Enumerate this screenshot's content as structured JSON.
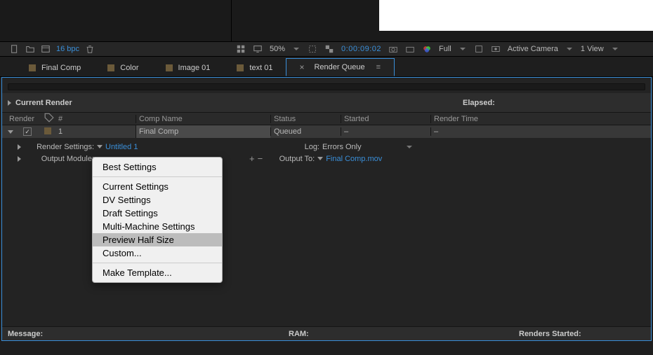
{
  "toolbar": {
    "bpc": "16 bpc",
    "zoom": "50%",
    "timecode": "0:00:09:02",
    "resolution": "Full",
    "camera": "Active Camera",
    "view": "1 View"
  },
  "tabs": [
    {
      "label": "Final Comp"
    },
    {
      "label": "Color"
    },
    {
      "label": "Image 01"
    },
    {
      "label": "text 01"
    },
    {
      "label": "Render Queue",
      "active": true,
      "closable": true
    }
  ],
  "current_render": {
    "label": "Current Render",
    "elapsed_label": "Elapsed:"
  },
  "columns": {
    "render": "Render",
    "num": "#",
    "comp": "Comp Name",
    "status": "Status",
    "started": "Started",
    "rtime": "Render Time"
  },
  "row": {
    "num": "1",
    "comp": "Final Comp",
    "status": "Queued",
    "started": "–",
    "rtime": "–"
  },
  "details": {
    "render_settings_label": "Render Settings:",
    "render_settings_value": "Untitled 1",
    "output_module_label": "Output Module:",
    "log_label": "Log:",
    "log_value": "Errors Only",
    "output_to_label": "Output To:",
    "output_to_value": "Final Comp.mov"
  },
  "menu": {
    "items": [
      "Best Settings",
      "Current Settings",
      "DV Settings",
      "Draft Settings",
      "Multi-Machine Settings",
      "Preview Half Size",
      "Custom..."
    ],
    "footer_item": "Make Template...",
    "highlighted_index": 5
  },
  "footer": {
    "message": "Message:",
    "ram": "RAM:",
    "renders_started": "Renders Started:"
  }
}
